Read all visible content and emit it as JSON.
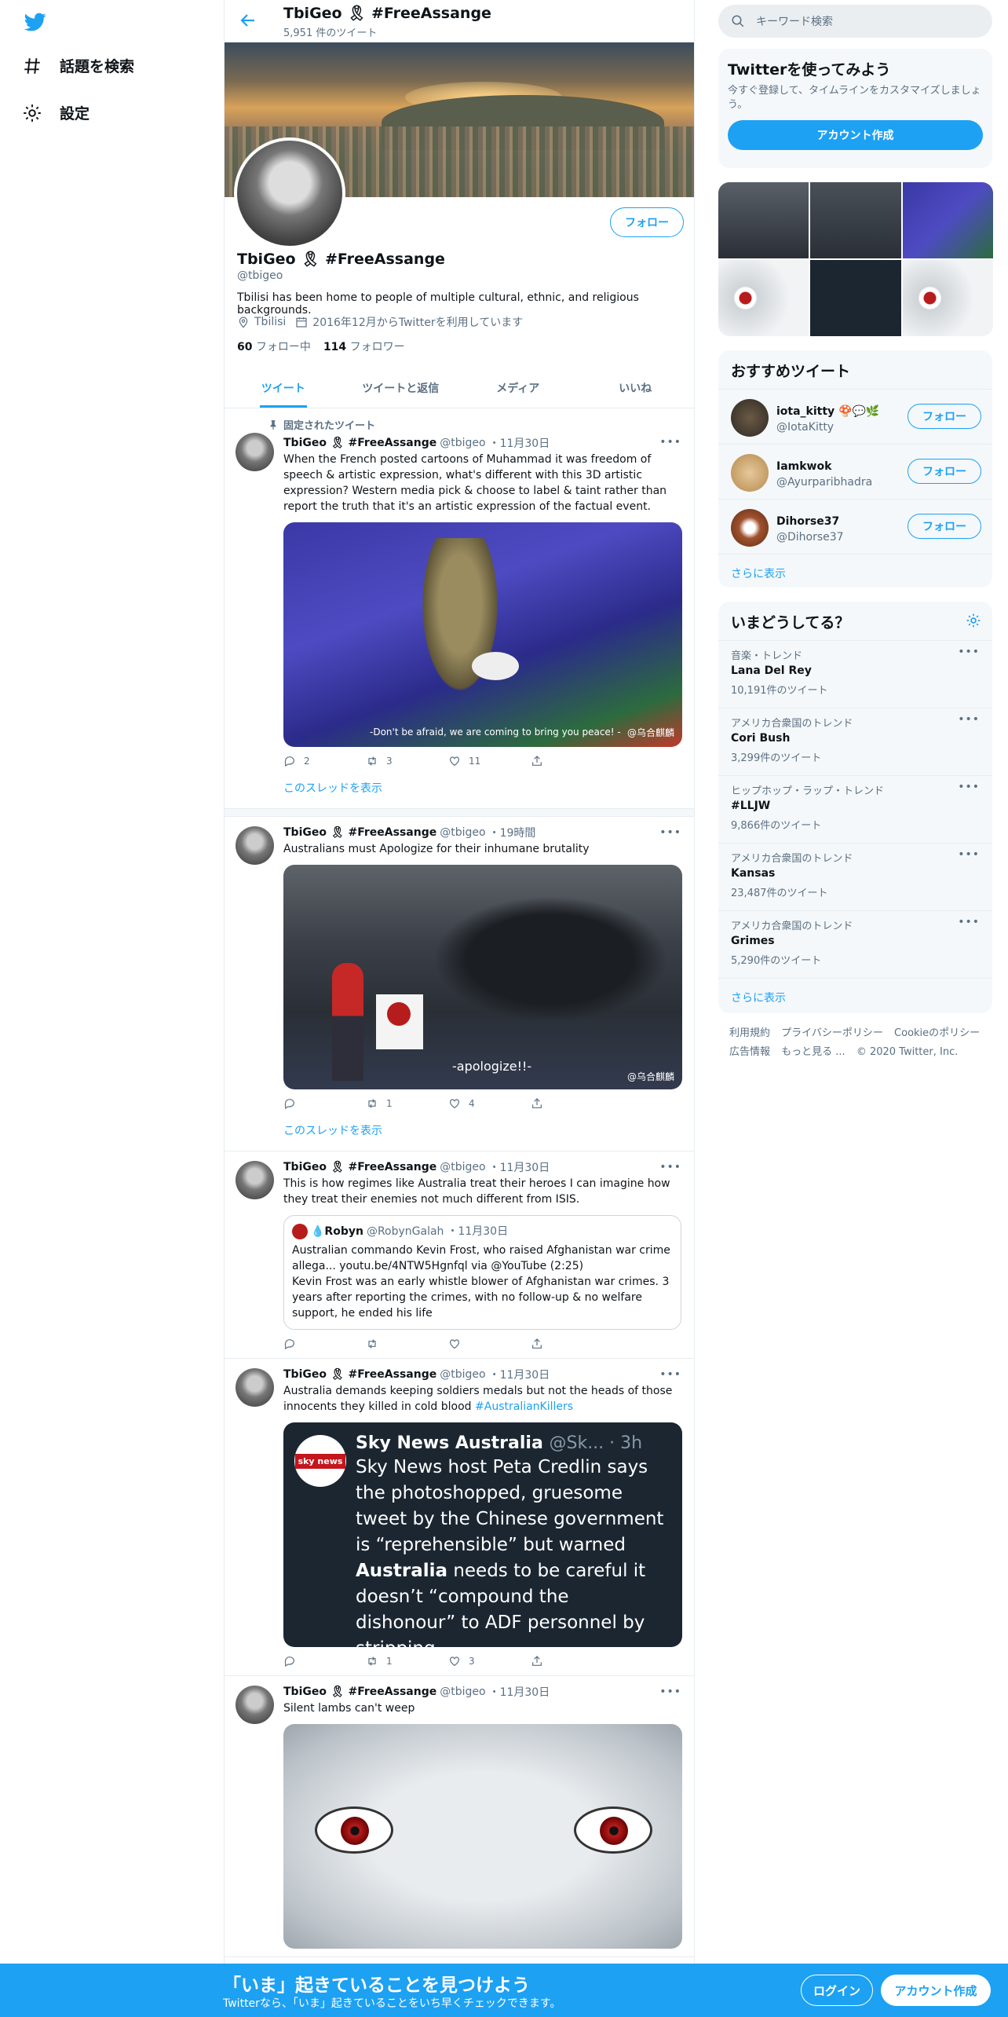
{
  "nav": {
    "explore": "話題を検索",
    "settings": "設定"
  },
  "header": {
    "name": "TbiGeo 🎗 #FreeAssange",
    "tweet_count": "5,951 件のツイート"
  },
  "profile": {
    "name": "TbiGeo 🎗 #FreeAssange",
    "handle": "@tbigeo",
    "bio": "Tbilisi has been home to people of multiple cultural, ethnic, and religious backgrounds.",
    "location": "Tbilisi",
    "joined": "2016年12月からTwitterを利用しています",
    "following_count": "60",
    "following_label": "フォロー中",
    "followers_count": "114",
    "followers_label": "フォロワー",
    "follow_button": "フォロー"
  },
  "tabs": [
    "ツイート",
    "ツイートと返信",
    "メディア",
    "いいね"
  ],
  "tweets": [
    {
      "pinned_label": "固定されたツイート",
      "name": "TbiGeo 🎗 #FreeAssange",
      "handle": "@tbigeo",
      "time": "・11月30日",
      "text": "When the French posted cartoons of Muhammad it was freedom of speech & artistic expression, what's different with this 3D artistic expression? Western media pick & choose to label & taint rather than report the truth that it's an artistic expression of the factual event.",
      "media_caption": "-Don't be afraid, we are coming to bring you peace! -",
      "media_watermark": "@乌合麒麟",
      "replies": "2",
      "retweets": "3",
      "likes": "11",
      "show_thread": "このスレッドを表示"
    },
    {
      "name": "TbiGeo 🎗 #FreeAssange",
      "handle": "@tbigeo",
      "time": "・19時間",
      "text": "Australians must Apologize for their inhumane brutality",
      "media_caption": "-apologize!!-",
      "media_watermark": "@乌合麒麟",
      "replies": "",
      "retweets": "1",
      "likes": "4",
      "show_thread": "このスレッドを表示"
    },
    {
      "name": "TbiGeo 🎗 #FreeAssange",
      "handle": "@tbigeo",
      "time": "・11月30日",
      "text": "This is how regimes like Australia treat their heroes I can imagine how they treat their enemies not much different from ISIS.",
      "quote_name": "💧Robyn",
      "quote_handle": "@RobynGalah",
      "quote_time": "・11月30日",
      "quote_text1": "Australian commando Kevin Frost, who raised Afghanistan war crime allega... youtu.be/4NTW5Hgnfql via @YouTube (2:25)",
      "quote_text2": "Kevin Frost was an early whistle blower of Afghanistan war crimes. 3 years after reporting the crimes, with no follow-up & no welfare support, he ended his life"
    },
    {
      "name": "TbiGeo 🎗 #FreeAssange",
      "handle": "@tbigeo",
      "time": "・11月30日",
      "text": "Australia demands keeping soldiers medals but not the heads of those innocents they killed in cold blood",
      "hashtag": "#AustralianKillers",
      "sky_logo": "sky news",
      "sky_name": "Sky News Australia",
      "sky_handle": "@Sk... · 3h",
      "sky_body_1": "Sky News host Peta Credlin says the photoshopped, gruesome tweet by the Chinese government is “reprehensible” but warned",
      "sky_body_bold": "Australia",
      "sky_body_2": "needs to be careful it doesn’t “compound the dishonour” to ADF personnel by stripping",
      "replies": "",
      "retweets": "1",
      "likes": "3"
    },
    {
      "name": "TbiGeo 🎗 #FreeAssange",
      "handle": "@tbigeo",
      "time": "・11月30日",
      "text": "Silent lambs can't weep"
    }
  ],
  "right": {
    "search_placeholder": "キーワード検索",
    "signup_title": "Twitterを使ってみよう",
    "signup_desc": "今すぐ登録して、タイムラインをカスタマイズしましょう。",
    "signup_button": "アカウント作成",
    "recs_title": "おすすめツイート",
    "recs": [
      {
        "name": "iota_kitty 🍄💬🌿",
        "handle": "@IotaKitty",
        "button": "フォロー"
      },
      {
        "name": "Iamkwok",
        "handle": "@Ayurparibhadra",
        "button": "フォロー"
      },
      {
        "name": "Dihorse37",
        "handle": "@Dihorse37",
        "button": "フォロー"
      }
    ],
    "recs_more": "さらに表示",
    "trends_title": "いまどうしてる？",
    "trends": [
      {
        "category": "音楽・トレンド",
        "name": "Lana Del Rey",
        "count": "10,191件のツイート"
      },
      {
        "category": "アメリカ合衆国のトレンド",
        "name": "Cori Bush",
        "count": "3,299件のツイート"
      },
      {
        "category": "ヒップホップ・ラップ・トレンド",
        "name": "#LLJW",
        "count": "9,866件のツイート"
      },
      {
        "category": "アメリカ合衆国のトレンド",
        "name": "Kansas",
        "count": "23,487件のツイート"
      },
      {
        "category": "アメリカ合衆国のトレンド",
        "name": "Grimes",
        "count": "5,290件のツイート"
      }
    ],
    "trends_more": "さらに表示",
    "footer": [
      "利用規約",
      "プライバシーポリシー",
      "Cookieのポリシー",
      "広告情報",
      "もっと見る ...",
      "© 2020 Twitter, Inc."
    ]
  },
  "bottom": {
    "title": "「いま」起きていることを見つけよう",
    "subtitle": "Twitterなら、「いま」起きていることをいち早くチェックできます。",
    "login": "ログイン",
    "signup": "アカウント作成"
  },
  "colors": {
    "accent": "#1da1f2",
    "text": "#0f1419",
    "secondary": "#5b7083"
  }
}
